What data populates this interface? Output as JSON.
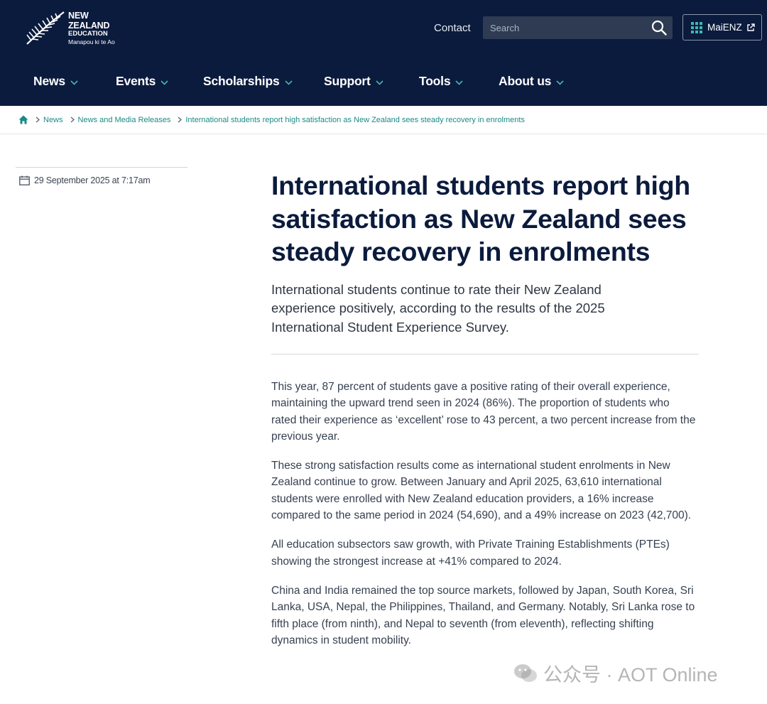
{
  "brand": {
    "line1": "NEW ZEALAND",
    "line2": "EDUCATION",
    "line3": "Manapou ki te Ao"
  },
  "header": {
    "contact_label": "Contact",
    "search_placeholder": "Search",
    "maienz_label": "MaiENZ"
  },
  "nav": {
    "items": [
      {
        "label": "News"
      },
      {
        "label": "Events"
      },
      {
        "label": "Scholarships"
      },
      {
        "label": "Support"
      },
      {
        "label": "Tools"
      },
      {
        "label": "About us"
      }
    ]
  },
  "breadcrumb": {
    "items": [
      {
        "label": "News"
      },
      {
        "label": "News and Media Releases"
      },
      {
        "label": "International students report high satisfaction as New Zealand sees steady recovery in enrolments"
      }
    ]
  },
  "article": {
    "date": "29 September 2025 at 7:17am",
    "title": "International students report high satisfaction as New Zealand sees steady recovery in enrolments",
    "lede": "International students continue to rate their New Zealand experience positively, according to the results of the 2025 International Student Experience Survey.",
    "paragraphs": [
      "This year, 87 percent of students gave a positive rating of their overall experience, maintaining the upward trend seen in 2024 (86%). The proportion of students who rated their experience as ‘excellent’ rose to 43 percent, a two percent increase from the previous year.",
      "These strong satisfaction results come as international student enrolments in New Zealand continue to grow. Between January and April 2025, 63,610 international students were enrolled with New Zealand education providers, a 16% increase compared to the same period in 2024 (54,690), and a 49% increase on 2023 (42,700).",
      "All education subsectors saw growth, with Private Training Establishments (PTEs) showing the strongest increase at +41% compared to 2024.",
      "China and India remained the top source markets, followed by Japan, South Korea, Sri Lanka, USA, Nepal, the Philippines, Thailand, and Germany. Notably, Sri Lanka rose to fifth place (from ninth), and Nepal to seventh (from eleventh), reflecting shifting dynamics in student mobility."
    ]
  },
  "watermark": {
    "text": "公众号 · AOT Online"
  },
  "icons": {
    "logo": "silver-fern-icon",
    "search": "search-icon",
    "maienz_grid": "grid-icon",
    "external": "external-link-icon",
    "nav_chevron": "chevron-down-icon",
    "home": "home-icon",
    "crumb_sep": "chevron-right-icon",
    "calendar": "calendar-icon",
    "wechat": "wechat-icon"
  },
  "colors": {
    "header_bg": "#0b1b3d",
    "link_teal": "#1a8a86",
    "title": "#0b1b3d"
  }
}
